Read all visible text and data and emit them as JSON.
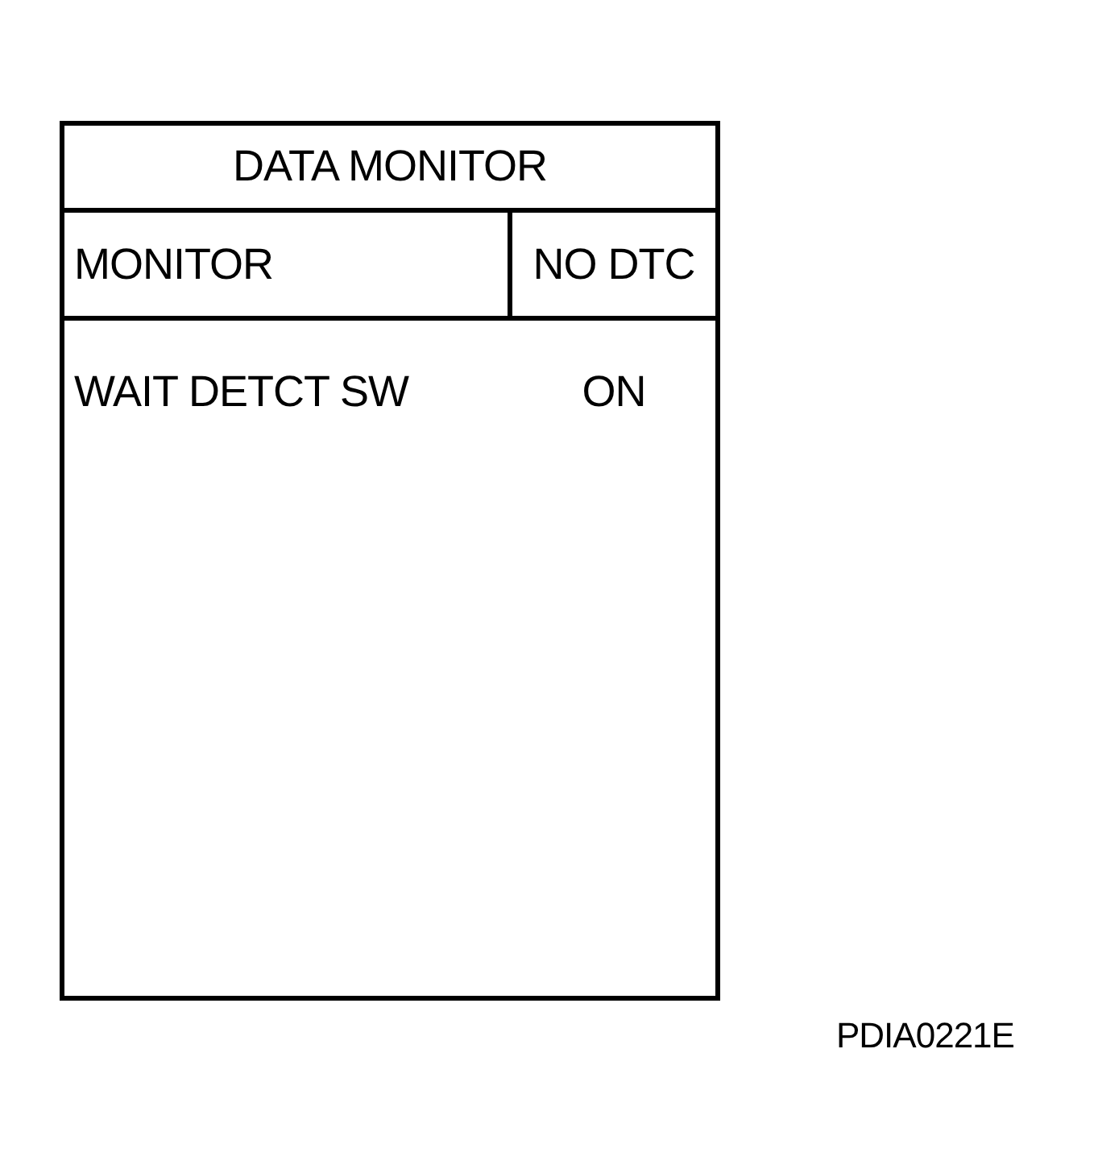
{
  "panel": {
    "title": "DATA MONITOR",
    "header": {
      "label": "MONITOR",
      "status": "NO DTC"
    },
    "items": [
      {
        "name": "WAIT DETCT SW",
        "value": "ON"
      }
    ]
  },
  "figure_code": "PDIA0221E"
}
